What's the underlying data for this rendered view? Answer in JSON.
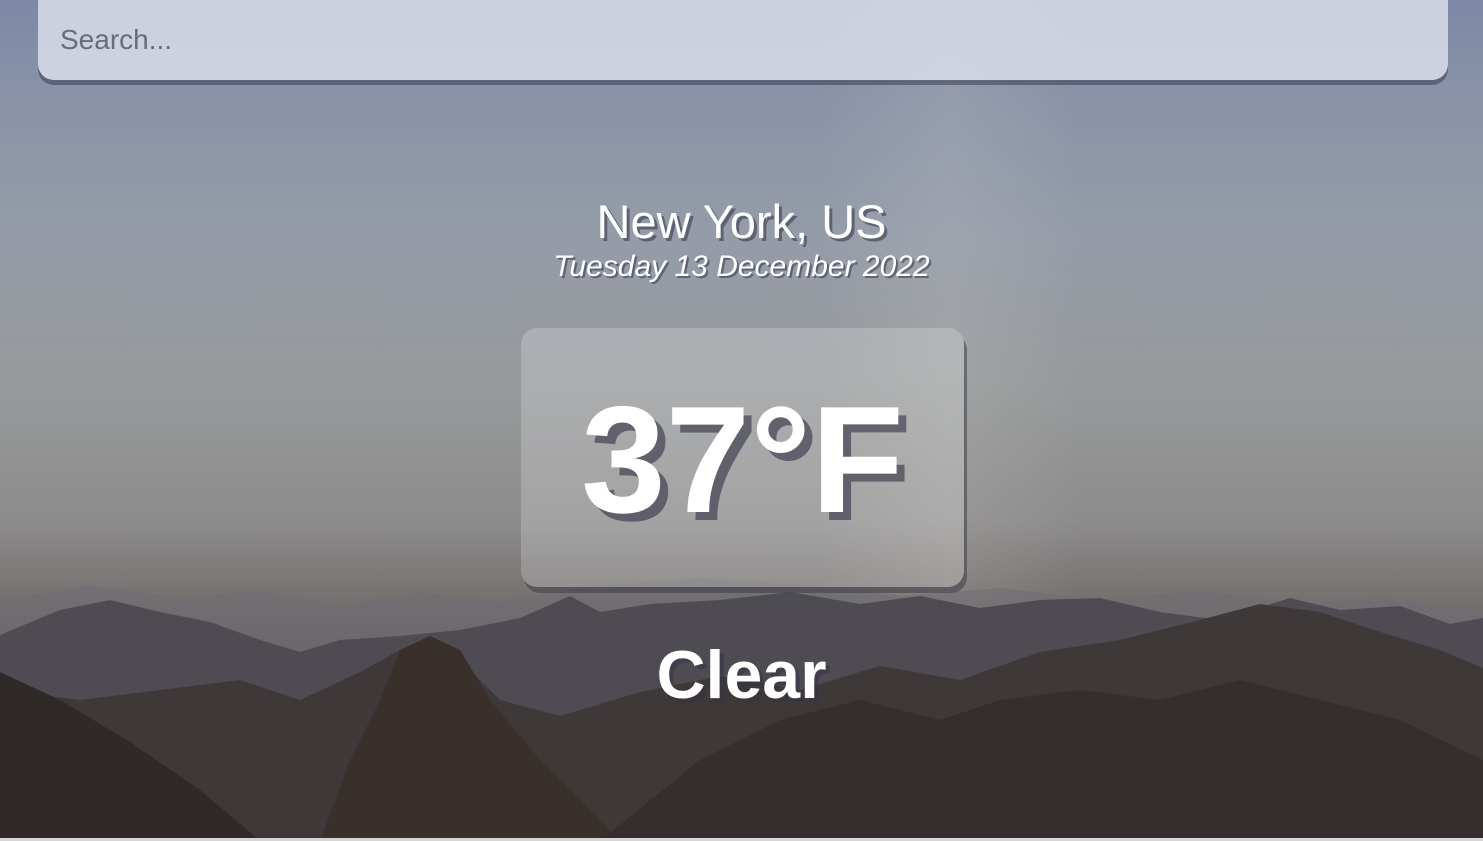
{
  "search": {
    "placeholder": "Search...",
    "value": ""
  },
  "weather": {
    "location": "New York, US",
    "date": "Tuesday 13 December 2022",
    "temperature": "37°F",
    "condition": "Clear"
  },
  "background": {
    "scene": "mountain-range-at-sunrise"
  }
}
